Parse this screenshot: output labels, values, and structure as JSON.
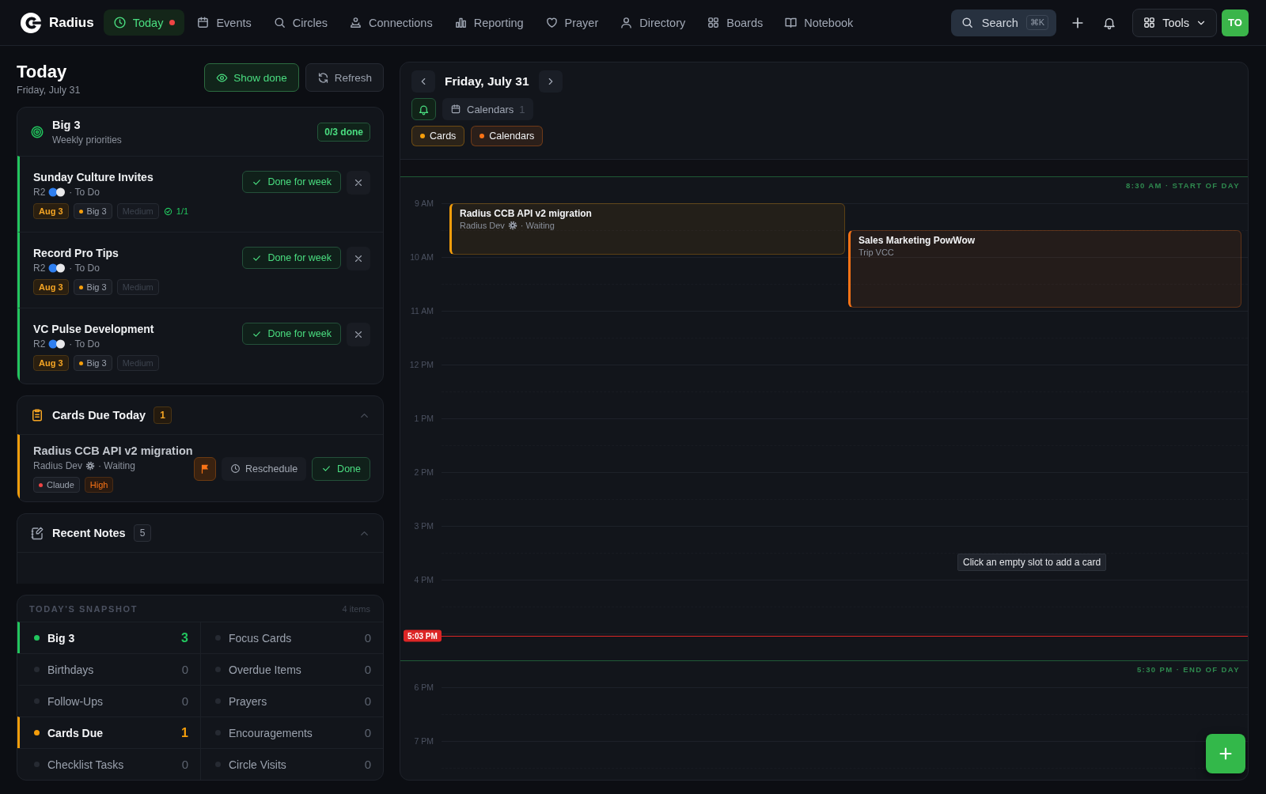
{
  "nav": {
    "brand": "Radius",
    "items": [
      {
        "label": "Today",
        "selected": true,
        "alert": true
      },
      {
        "label": "Events",
        "selected": false,
        "alert": false
      },
      {
        "label": "Circles",
        "selected": false,
        "alert": false
      },
      {
        "label": "Connections",
        "selected": false,
        "alert": false
      },
      {
        "label": "Reporting",
        "selected": false,
        "alert": false
      },
      {
        "label": "Prayer",
        "selected": false,
        "alert": false
      },
      {
        "label": "Directory",
        "selected": false,
        "alert": false
      },
      {
        "label": "Boards",
        "selected": false,
        "alert": false
      },
      {
        "label": "Notebook",
        "selected": false,
        "alert": false
      }
    ],
    "search": {
      "label": "Search",
      "shortcut": "⌘K"
    },
    "tools": "Tools",
    "avatar": "TO"
  },
  "today": {
    "title": "Today",
    "date": "Friday, July 31",
    "show_done": "Show done",
    "refresh": "Refresh"
  },
  "big3": {
    "title": "Big 3",
    "subtitle": "Weekly priorities",
    "progress": "0/3 done",
    "items": [
      {
        "title": "Sunday Culture Invites",
        "project": "R2",
        "status": "· To Do",
        "action": "Done for week",
        "tags": [
          {
            "kind": "due",
            "text": "Aug 3"
          },
          {
            "kind": "label",
            "text": "Big 3",
            "color": "#f59e0b"
          },
          {
            "kind": "medium",
            "text": "Medium"
          },
          {
            "kind": "checklist",
            "text": "1/1"
          }
        ]
      },
      {
        "title": "Record Pro Tips",
        "project": "R2",
        "status": "· To Do",
        "action": "Done for week",
        "tags": [
          {
            "kind": "due",
            "text": "Aug 3"
          },
          {
            "kind": "label",
            "text": "Big 3",
            "color": "#f59e0b"
          },
          {
            "kind": "medium",
            "text": "Medium"
          }
        ]
      },
      {
        "title": "VC Pulse Development",
        "project": "R2",
        "status": "· To Do",
        "action": "Done for week",
        "tags": [
          {
            "kind": "due",
            "text": "Aug 3"
          },
          {
            "kind": "label",
            "text": "Big 3",
            "color": "#f59e0b"
          },
          {
            "kind": "medium",
            "text": "Medium"
          }
        ]
      }
    ]
  },
  "cards_due": {
    "title": "Cards Due Today",
    "count": "1",
    "expanded": true,
    "items": [
      {
        "title": "Radius CCB API v2 migration",
        "project": "Radius Dev",
        "status": "· Waiting",
        "flagged": true,
        "reschedule": "Reschedule",
        "done": "Done",
        "tags": [
          {
            "kind": "label",
            "text": "Claude",
            "color": "#ef4444"
          },
          {
            "kind": "high",
            "text": "High"
          }
        ]
      }
    ]
  },
  "recent_notes": {
    "title": "Recent Notes",
    "count": "5",
    "expanded": true
  },
  "snapshot": {
    "title": "TODAY'S SNAPSHOT",
    "count": "4 items",
    "items": [
      {
        "label": "Big 3",
        "value": "3",
        "active": true,
        "color": "#22c55e"
      },
      {
        "label": "Focus Cards",
        "value": "0",
        "active": false
      },
      {
        "label": "Birthdays",
        "value": "0",
        "active": false
      },
      {
        "label": "Overdue Items",
        "value": "0",
        "active": false
      },
      {
        "label": "Follow-Ups",
        "value": "0",
        "active": false
      },
      {
        "label": "Prayers",
        "value": "0",
        "active": false
      },
      {
        "label": "Cards Due",
        "value": "1",
        "active": true,
        "color": "#f59e0b"
      },
      {
        "label": "Encouragements",
        "value": "0",
        "active": false
      },
      {
        "label": "Checklist Tasks",
        "value": "0",
        "active": false
      },
      {
        "label": "Circle Visits",
        "value": "0",
        "active": false
      }
    ]
  },
  "calendar": {
    "date": "Friday, July 31",
    "reminders_on": true,
    "calendars": {
      "label": "Calendars",
      "count": "1"
    },
    "filters": [
      {
        "label": "Cards",
        "color": "#f59e0b"
      },
      {
        "label": "Calendars",
        "color": "#f97316"
      }
    ],
    "hours": [
      "9 AM",
      "10 AM",
      "11 AM",
      "12 PM",
      "1 PM",
      "2 PM",
      "3 PM",
      "4 PM",
      "6 PM",
      "7 PM"
    ],
    "start_of_day": "8:30 AM · START OF DAY",
    "end_of_day": "5:30 PM · END OF DAY",
    "now": "5:03 PM",
    "events": [
      {
        "title": "Radius CCB API v2 migration",
        "project": "Radius Dev",
        "status": "· Waiting",
        "color": "#f59e0b"
      },
      {
        "title": "Sales Marketing PowWow",
        "project": "Trip VCC",
        "color": "#f97316"
      }
    ],
    "hint": "Click an empty slot to add a card"
  }
}
